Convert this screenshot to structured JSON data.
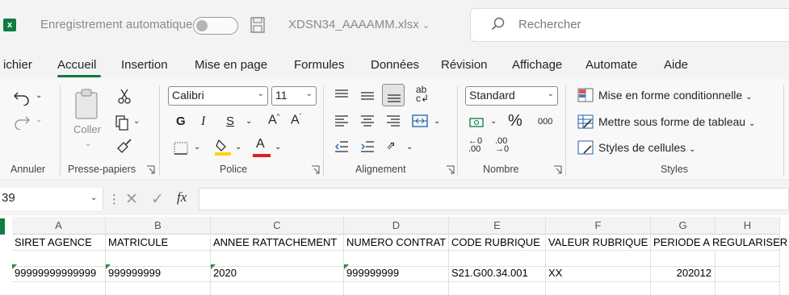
{
  "titlebar": {
    "app_icon": "excel-logo",
    "autosave_label": "Enregistrement automatique",
    "autosave_toggle_text": "",
    "autosave_state": "off",
    "filename": "XDSN34_AAAAMM.xlsx",
    "filename_chevron": "chevron-down-icon",
    "search_placeholder": "Rechercher"
  },
  "tabs": {
    "items": [
      "Fichier",
      "Accueil",
      "Insertion",
      "Mise en page",
      "Formules",
      "Données",
      "Révision",
      "Affichage",
      "Automate",
      "Aide"
    ],
    "active": "Accueil",
    "first_visible_text": "ichier"
  },
  "ribbon": {
    "groups": {
      "annuler": "Annuler",
      "presse_papiers": "Presse-papiers",
      "police": "Police",
      "alignement": "Alignement",
      "nombre": "Nombre",
      "styles": "Styles"
    },
    "coller_label": "Coller",
    "font_name": "Calibri",
    "font_size": "11",
    "number_format": "Standard",
    "percent_symbol": "%",
    "thousands_label": "000",
    "styles_items": [
      "Mise en forme conditionnelle",
      "Mettre sous forme de tableau",
      "Styles de cellules"
    ],
    "accent_color": "#107c41",
    "highlight_color": "#ffd400",
    "font_color": "#e02020"
  },
  "formula_bar": {
    "name_box": "39",
    "fx_label": "fx",
    "content": ""
  },
  "grid": {
    "columns": [
      "A",
      "B",
      "C",
      "D",
      "E",
      "F",
      "G",
      "H"
    ],
    "rows": [
      [
        "SIRET AGENCE",
        "MATRICULE",
        "ANNEE RATTACHEMENT",
        "NUMERO CONTRAT",
        "CODE RUBRIQUE",
        "VALEUR RUBRIQUE",
        "PERIODE A REGULARISER",
        ""
      ],
      [
        "",
        "",
        "",
        "",
        "",
        "",
        "",
        ""
      ],
      [
        "99999999999999",
        "999999999",
        "2020",
        "999999999",
        "S21.G00.34.001",
        "XX",
        "202012",
        ""
      ]
    ]
  }
}
